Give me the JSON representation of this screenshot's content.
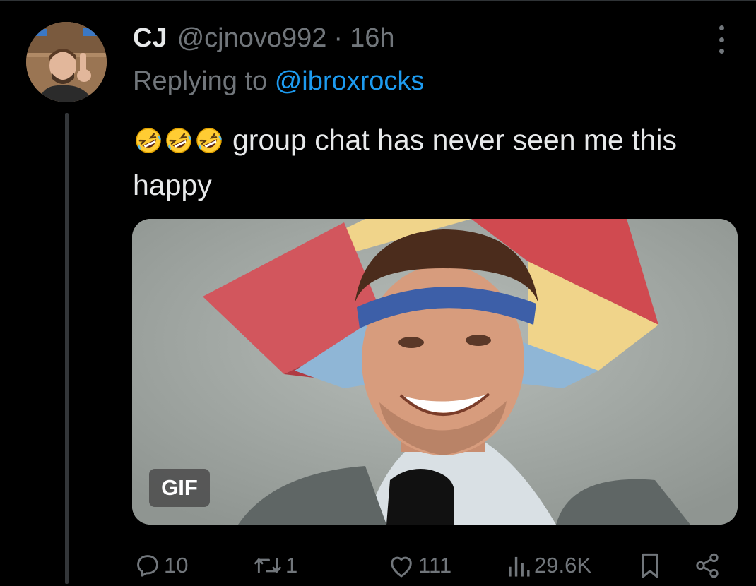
{
  "tweet": {
    "author_name": "CJ",
    "author_handle": "@cjnovo992",
    "separator": "·",
    "time": "16h",
    "replying_to_label": "Replying to",
    "replying_to_handle": "@ibroxrocks",
    "text": "group chat has never seen me this happy",
    "emojis": [
      "rolling-on-floor-laughing-emoji",
      "rolling-on-floor-laughing-emoji",
      "rolling-on-floor-laughing-emoji"
    ],
    "media_badge": "GIF"
  },
  "actions": {
    "replies": "10",
    "reposts": "1",
    "likes": "111",
    "views": "29.6K"
  },
  "colors": {
    "background": "#000000",
    "primary_text": "#e7e9ea",
    "secondary_text": "#71767b",
    "link": "#1d9bf0",
    "thread_line": "#333639"
  }
}
